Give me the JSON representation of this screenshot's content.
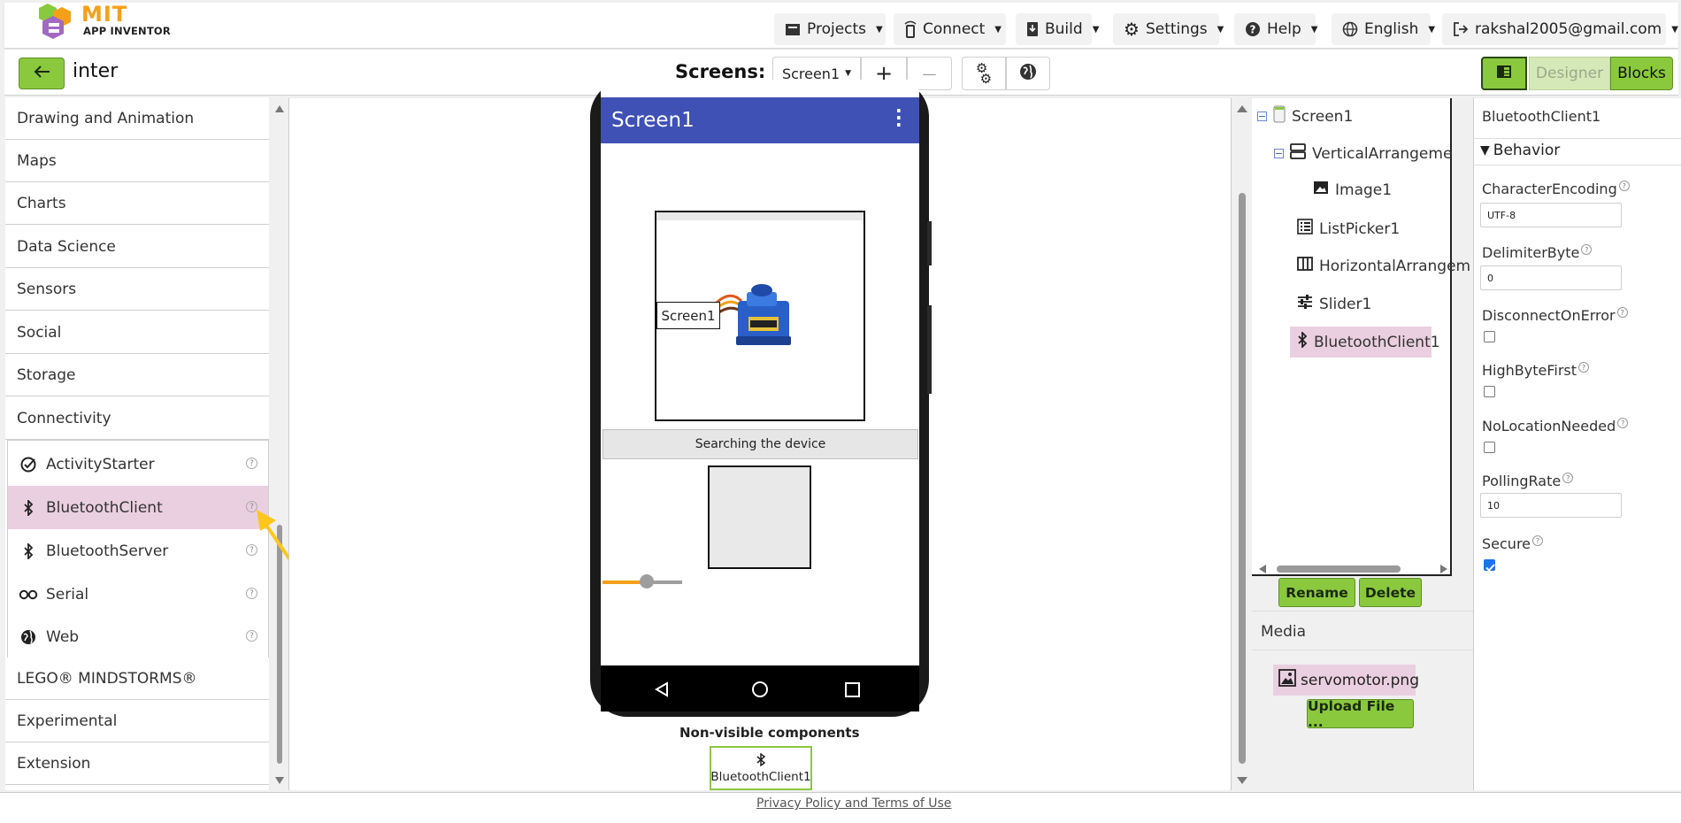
{
  "header": {
    "logo_text": "MIT",
    "logo_sub": "APP INVENTOR",
    "menus": [
      {
        "label": "Projects",
        "icon": "folder-icon"
      },
      {
        "label": "Connect",
        "icon": "phone-connect-icon"
      },
      {
        "label": "Build",
        "icon": "build-icon"
      },
      {
        "label": "Settings",
        "icon": "gear-icon"
      },
      {
        "label": "Help",
        "icon": "help-icon"
      },
      {
        "label": "English",
        "icon": "globe-icon"
      },
      {
        "label": "rakshal2005@gmail.com",
        "icon": "logout-icon"
      }
    ]
  },
  "toolbar": {
    "project_name": "inter",
    "screens_label": "Screens:",
    "current_screen": "Screen1",
    "add_screen": "+",
    "remove_screen": "—",
    "designer_label": "Designer",
    "blocks_label": "Blocks"
  },
  "palette": {
    "categories_top": [
      "Drawing and Animation",
      "Maps",
      "Charts",
      "Data Science",
      "Sensors",
      "Social",
      "Storage",
      "Connectivity"
    ],
    "connectivity_items": [
      {
        "label": "ActivityStarter",
        "icon": "activity-starter-icon",
        "selected": false
      },
      {
        "label": "BluetoothClient",
        "icon": "bluetooth-icon",
        "selected": true
      },
      {
        "label": "BluetoothServer",
        "icon": "bluetooth-icon",
        "selected": false
      },
      {
        "label": "Serial",
        "icon": "serial-icon",
        "selected": false
      },
      {
        "label": "Web",
        "icon": "web-globe-icon",
        "selected": false
      }
    ],
    "categories_bottom": [
      "LEGO® MINDSTORMS®",
      "Experimental",
      "Extension"
    ],
    "help_glyph": "?"
  },
  "viewer": {
    "screen_title": "Screen1",
    "image_overlay_label": "Screen1",
    "list_picker_text": "Searching the device",
    "slider_value": 0.56,
    "non_visible_label": "Non-visible components",
    "non_visible_items": [
      "BluetoothClient1"
    ]
  },
  "components": {
    "tree": [
      {
        "label": "Screen1",
        "level": 0,
        "toggle": "⊖",
        "icon": "screen-icon"
      },
      {
        "label": "VerticalArrangeme",
        "level": 1,
        "toggle": "⊖",
        "icon": "vertical-arrangement-icon"
      },
      {
        "label": "Image1",
        "level": 2,
        "toggle": "",
        "icon": "image-icon"
      },
      {
        "label": "ListPicker1",
        "level": 1,
        "toggle": "",
        "icon": "list-picker-icon"
      },
      {
        "label": "HorizontalArrangem",
        "level": 1,
        "toggle": "",
        "icon": "horizontal-arrangement-icon"
      },
      {
        "label": "Slider1",
        "level": 1,
        "toggle": "",
        "icon": "slider-icon"
      },
      {
        "label": "BluetoothClient1",
        "level": 1,
        "toggle": "",
        "icon": "bluetooth-icon",
        "selected": true
      }
    ],
    "rename_label": "Rename",
    "delete_label": "Delete",
    "media_label": "Media",
    "media_files": [
      "servomotor.png"
    ],
    "upload_label": "Upload File ..."
  },
  "properties": {
    "component_name": "BluetoothClient1",
    "section": "Behavior",
    "items": [
      {
        "label": "CharacterEncoding",
        "type": "text",
        "value": "UTF-8"
      },
      {
        "label": "DelimiterByte",
        "type": "text",
        "value": "0"
      },
      {
        "label": "DisconnectOnError",
        "type": "check",
        "checked": false
      },
      {
        "label": "HighByteFirst",
        "type": "check",
        "checked": false
      },
      {
        "label": "NoLocationNeeded",
        "type": "check",
        "checked": false
      },
      {
        "label": "PollingRate",
        "type": "text",
        "value": "10"
      },
      {
        "label": "Secure",
        "type": "check",
        "checked": true
      }
    ]
  },
  "footer": {
    "link": "Privacy Policy and Terms of Use"
  },
  "colors": {
    "accent_green": "#8ac93e",
    "selected_pink": "#eacfe0",
    "screen_title_blue": "#3f51b5",
    "slider_orange": "#f6a019",
    "annotation_arrow": "#ffc61a"
  }
}
